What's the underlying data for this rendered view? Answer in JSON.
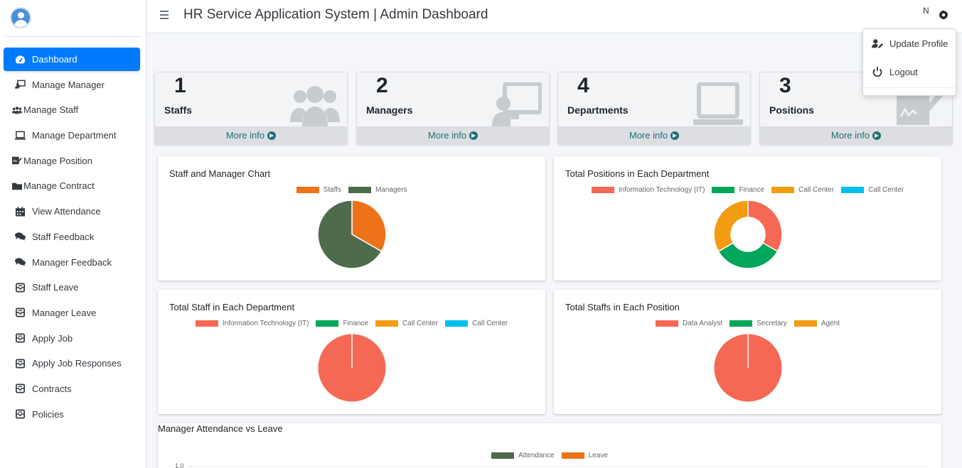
{
  "header": {
    "title": "HR Service Application System | Admin Dashboard",
    "user_initial": "N"
  },
  "dropdown": {
    "items": [
      {
        "label": "Update Profile",
        "icon": "user-edit-icon"
      },
      {
        "label": "Logout",
        "icon": "power-icon"
      }
    ]
  },
  "sidebar": {
    "items": [
      {
        "label": "Dashboard",
        "icon": "tachometer-icon",
        "active": true
      },
      {
        "label": "Manage Manager",
        "icon": "chalkboard-teacher-icon"
      },
      {
        "label": "Manage Staff",
        "icon": "users-icon"
      },
      {
        "label": "Manage Department",
        "icon": "laptop-icon"
      },
      {
        "label": "Manage Position",
        "icon": "signature-icon"
      },
      {
        "label": "Manage Contract",
        "icon": "folder-icon"
      },
      {
        "label": "View Attendance",
        "icon": "calendar-icon"
      },
      {
        "label": "Staff Feedback",
        "icon": "comments-icon"
      },
      {
        "label": "Manager Feedback",
        "icon": "comments-icon"
      },
      {
        "label": "Staff Leave",
        "icon": "inbox-icon"
      },
      {
        "label": "Manager Leave",
        "icon": "inbox-icon"
      },
      {
        "label": "Apply Job",
        "icon": "inbox-icon"
      },
      {
        "label": "Apply Job Responses",
        "icon": "inbox-icon"
      },
      {
        "label": "Contracts",
        "icon": "inbox-icon"
      },
      {
        "label": "Policies",
        "icon": "inbox-icon"
      }
    ]
  },
  "stats": [
    {
      "count": "1",
      "label": "Staffs",
      "link": "More info",
      "icon": "users-icon"
    },
    {
      "count": "2",
      "label": "Managers",
      "link": "More info",
      "icon": "chalkboard-teacher-icon"
    },
    {
      "count": "4",
      "label": "Departments",
      "link": "More info",
      "icon": "laptop-icon"
    },
    {
      "count": "3",
      "label": "Positions",
      "link": "More info",
      "icon": "signature-icon"
    }
  ],
  "colors": {
    "orange": "#ee7218",
    "darkgreen": "#4e6b4c",
    "red": "#f56954",
    "green": "#00a65a",
    "amber": "#f39c12",
    "cyan": "#00c0ef",
    "accent": "#007bff"
  },
  "chart_data": [
    {
      "type": "pie",
      "title": "Staff and Manager Chart",
      "categories": [
        "Staffs",
        "Managers"
      ],
      "values": [
        1,
        2
      ],
      "colors": [
        "#ee7218",
        "#4e6b4c"
      ]
    },
    {
      "type": "pie",
      "donut": true,
      "title": "Total Positions in Each Department",
      "categories": [
        "Information Technology (IT)",
        "Finance",
        "Call Center",
        "Call Center"
      ],
      "values": [
        1,
        1,
        1,
        0
      ],
      "colors": [
        "#f56954",
        "#00a65a",
        "#f39c12",
        "#00c0ef"
      ]
    },
    {
      "type": "pie",
      "title": "Total Staff in Each Department",
      "categories": [
        "Information Technology (IT)",
        "Finance",
        "Call Center",
        "Call Center"
      ],
      "values": [
        1,
        0,
        0,
        0
      ],
      "colors": [
        "#f56954",
        "#00a65a",
        "#f39c12",
        "#00c0ef"
      ]
    },
    {
      "type": "pie",
      "title": "Total Staffs in Each Position",
      "categories": [
        "Data Analyst",
        "Secretary",
        "Agent"
      ],
      "values": [
        1,
        0,
        0
      ],
      "colors": [
        "#f56954",
        "#00a65a",
        "#f39c12"
      ]
    },
    {
      "type": "bar",
      "title": "Manager Attendance vs Leave",
      "series": [
        {
          "name": "Attendance",
          "color": "#4e6b4c"
        },
        {
          "name": "Leave",
          "color": "#ee7218"
        }
      ],
      "ylim": [
        0,
        1.0
      ],
      "yticks": [
        "1.0"
      ]
    }
  ]
}
